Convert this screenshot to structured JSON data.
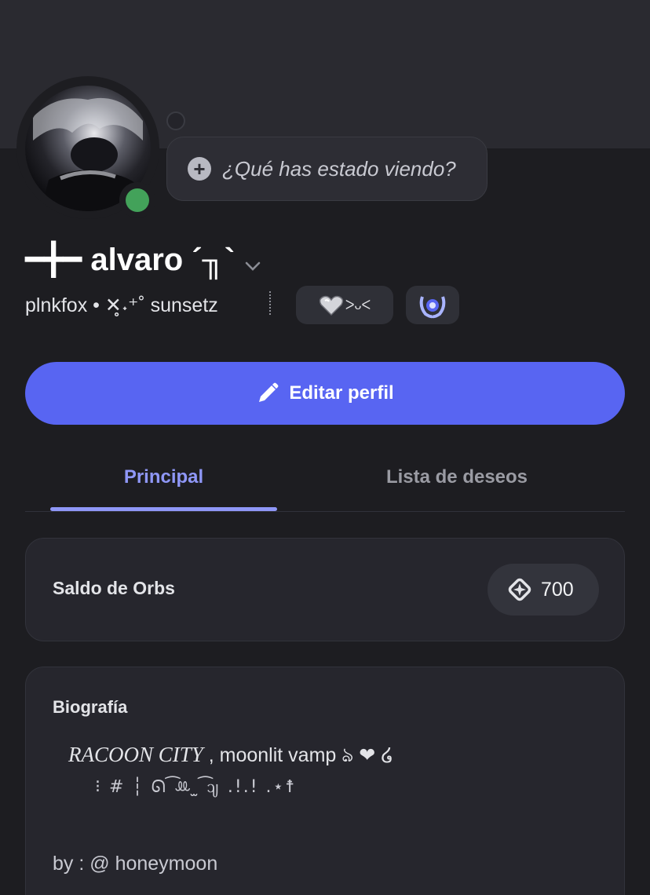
{
  "profile": {
    "status_prompt": "¿Qué has estado viendo?",
    "display_name": "━╋━ alvaro ´╖`",
    "username": "plnkfox",
    "separator": " • ",
    "pronouns": "✕̥˖⁺˚ sunsetz",
    "badge_heart_text": "ᐳᴗᐸ",
    "online_status_color": "#43a25a"
  },
  "actions": {
    "edit_profile_label": "Editar perfil"
  },
  "tabs": [
    {
      "label": "Principal",
      "active": true
    },
    {
      "label": "Lista de deseos",
      "active": false
    }
  ],
  "orbs": {
    "label": "Saldo de Orbs",
    "value": "700"
  },
  "bio": {
    "label": "Biografía",
    "line1_title": "RACOON CITY",
    "line1_rest": " , moonlit vamp ঌ ❤ ໒",
    "line2": "⁝ # ┆ ᘏ ͡ꔛ ̫ ͡ᦻ .!.! .⋆☨",
    "line3": "by : @ honeymoon"
  },
  "colors": {
    "accent": "#5865f2",
    "tab_active": "#8f97f7",
    "background": "#1d1d21",
    "card": "#26262d"
  },
  "icons": [
    "plus-icon",
    "chevron-down-icon",
    "pencil-icon",
    "heart-badge-icon",
    "laurel-badge-icon",
    "orb-icon"
  ]
}
